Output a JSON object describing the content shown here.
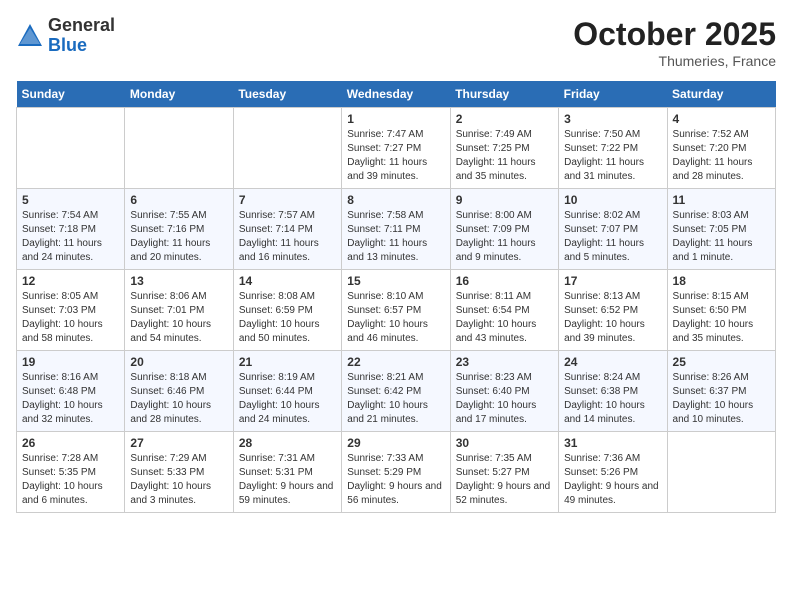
{
  "header": {
    "logo_general": "General",
    "logo_blue": "Blue",
    "month": "October 2025",
    "location": "Thumeries, France"
  },
  "days_of_week": [
    "Sunday",
    "Monday",
    "Tuesday",
    "Wednesday",
    "Thursday",
    "Friday",
    "Saturday"
  ],
  "weeks": [
    [
      {
        "day": "",
        "info": ""
      },
      {
        "day": "",
        "info": ""
      },
      {
        "day": "",
        "info": ""
      },
      {
        "day": "1",
        "info": "Sunrise: 7:47 AM\nSunset: 7:27 PM\nDaylight: 11 hours and 39 minutes."
      },
      {
        "day": "2",
        "info": "Sunrise: 7:49 AM\nSunset: 7:25 PM\nDaylight: 11 hours and 35 minutes."
      },
      {
        "day": "3",
        "info": "Sunrise: 7:50 AM\nSunset: 7:22 PM\nDaylight: 11 hours and 31 minutes."
      },
      {
        "day": "4",
        "info": "Sunrise: 7:52 AM\nSunset: 7:20 PM\nDaylight: 11 hours and 28 minutes."
      }
    ],
    [
      {
        "day": "5",
        "info": "Sunrise: 7:54 AM\nSunset: 7:18 PM\nDaylight: 11 hours and 24 minutes."
      },
      {
        "day": "6",
        "info": "Sunrise: 7:55 AM\nSunset: 7:16 PM\nDaylight: 11 hours and 20 minutes."
      },
      {
        "day": "7",
        "info": "Sunrise: 7:57 AM\nSunset: 7:14 PM\nDaylight: 11 hours and 16 minutes."
      },
      {
        "day": "8",
        "info": "Sunrise: 7:58 AM\nSunset: 7:11 PM\nDaylight: 11 hours and 13 minutes."
      },
      {
        "day": "9",
        "info": "Sunrise: 8:00 AM\nSunset: 7:09 PM\nDaylight: 11 hours and 9 minutes."
      },
      {
        "day": "10",
        "info": "Sunrise: 8:02 AM\nSunset: 7:07 PM\nDaylight: 11 hours and 5 minutes."
      },
      {
        "day": "11",
        "info": "Sunrise: 8:03 AM\nSunset: 7:05 PM\nDaylight: 11 hours and 1 minute."
      }
    ],
    [
      {
        "day": "12",
        "info": "Sunrise: 8:05 AM\nSunset: 7:03 PM\nDaylight: 10 hours and 58 minutes."
      },
      {
        "day": "13",
        "info": "Sunrise: 8:06 AM\nSunset: 7:01 PM\nDaylight: 10 hours and 54 minutes."
      },
      {
        "day": "14",
        "info": "Sunrise: 8:08 AM\nSunset: 6:59 PM\nDaylight: 10 hours and 50 minutes."
      },
      {
        "day": "15",
        "info": "Sunrise: 8:10 AM\nSunset: 6:57 PM\nDaylight: 10 hours and 46 minutes."
      },
      {
        "day": "16",
        "info": "Sunrise: 8:11 AM\nSunset: 6:54 PM\nDaylight: 10 hours and 43 minutes."
      },
      {
        "day": "17",
        "info": "Sunrise: 8:13 AM\nSunset: 6:52 PM\nDaylight: 10 hours and 39 minutes."
      },
      {
        "day": "18",
        "info": "Sunrise: 8:15 AM\nSunset: 6:50 PM\nDaylight: 10 hours and 35 minutes."
      }
    ],
    [
      {
        "day": "19",
        "info": "Sunrise: 8:16 AM\nSunset: 6:48 PM\nDaylight: 10 hours and 32 minutes."
      },
      {
        "day": "20",
        "info": "Sunrise: 8:18 AM\nSunset: 6:46 PM\nDaylight: 10 hours and 28 minutes."
      },
      {
        "day": "21",
        "info": "Sunrise: 8:19 AM\nSunset: 6:44 PM\nDaylight: 10 hours and 24 minutes."
      },
      {
        "day": "22",
        "info": "Sunrise: 8:21 AM\nSunset: 6:42 PM\nDaylight: 10 hours and 21 minutes."
      },
      {
        "day": "23",
        "info": "Sunrise: 8:23 AM\nSunset: 6:40 PM\nDaylight: 10 hours and 17 minutes."
      },
      {
        "day": "24",
        "info": "Sunrise: 8:24 AM\nSunset: 6:38 PM\nDaylight: 10 hours and 14 minutes."
      },
      {
        "day": "25",
        "info": "Sunrise: 8:26 AM\nSunset: 6:37 PM\nDaylight: 10 hours and 10 minutes."
      }
    ],
    [
      {
        "day": "26",
        "info": "Sunrise: 7:28 AM\nSunset: 5:35 PM\nDaylight: 10 hours and 6 minutes."
      },
      {
        "day": "27",
        "info": "Sunrise: 7:29 AM\nSunset: 5:33 PM\nDaylight: 10 hours and 3 minutes."
      },
      {
        "day": "28",
        "info": "Sunrise: 7:31 AM\nSunset: 5:31 PM\nDaylight: 9 hours and 59 minutes."
      },
      {
        "day": "29",
        "info": "Sunrise: 7:33 AM\nSunset: 5:29 PM\nDaylight: 9 hours and 56 minutes."
      },
      {
        "day": "30",
        "info": "Sunrise: 7:35 AM\nSunset: 5:27 PM\nDaylight: 9 hours and 52 minutes."
      },
      {
        "day": "31",
        "info": "Sunrise: 7:36 AM\nSunset: 5:26 PM\nDaylight: 9 hours and 49 minutes."
      },
      {
        "day": "",
        "info": ""
      }
    ]
  ]
}
